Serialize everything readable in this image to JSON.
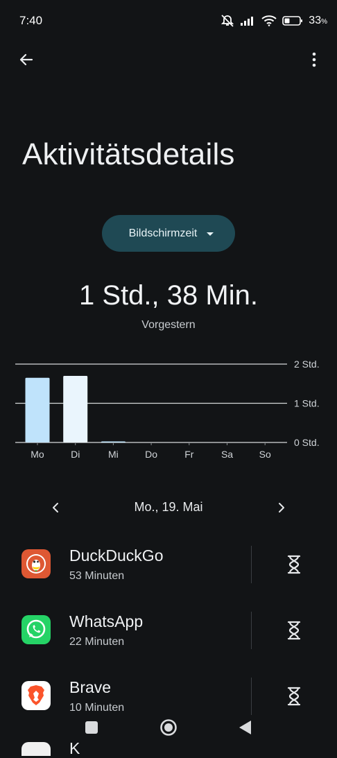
{
  "status_bar": {
    "time": "7:40",
    "battery_percent": "33",
    "battery_unit": "%"
  },
  "header": {
    "title": "Aktivitätsdetails"
  },
  "metric_dropdown": {
    "label": "Bildschirmzeit"
  },
  "summary": {
    "total": "1 Std., 38 Min.",
    "day_label": "Vorgestern"
  },
  "chart_data": {
    "type": "bar",
    "categories": [
      "Mo",
      "Di",
      "Mi",
      "Do",
      "Fr",
      "Sa",
      "So"
    ],
    "values": [
      1.65,
      1.7,
      0.02,
      0,
      0,
      0,
      0
    ],
    "ylim": [
      0,
      2
    ],
    "y_ticks": [
      {
        "value": 2,
        "label": "2 Std."
      },
      {
        "value": 1,
        "label": "1 Std."
      },
      {
        "value": 0,
        "label": "0 Std."
      }
    ],
    "selected_index": 1,
    "colors": {
      "bar": "#bfe3fb",
      "bar_selected": "#eaf5fd",
      "grid": "#d8dadc"
    }
  },
  "date_nav": {
    "date": "Mo., 19. Mai"
  },
  "apps": [
    {
      "name": "DuckDuckGo",
      "time": "53 Minuten",
      "icon": "duckduckgo-icon",
      "color": "#de5833"
    },
    {
      "name": "WhatsApp",
      "time": "22 Minuten",
      "icon": "whatsapp-icon",
      "color": "#25d366"
    },
    {
      "name": "Brave",
      "time": "10 Minuten",
      "icon": "brave-icon",
      "color": "#ffffff"
    }
  ],
  "partial_app": {
    "name": "K"
  }
}
